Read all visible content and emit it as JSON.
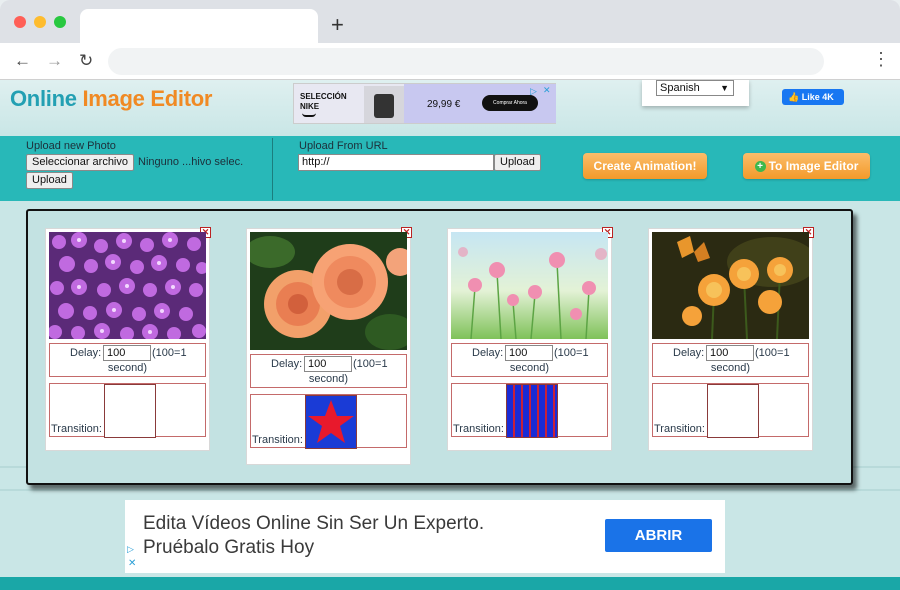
{
  "colors": {
    "teal_bar": "#28b8b8",
    "page_bg": "#c9e6e6",
    "orange_button": "#f39a2a",
    "logo_blue": "#23a0b3",
    "logo_orange": "#f08a24",
    "fb_blue": "#1877f2",
    "ad_button_blue": "#1a73e8"
  },
  "browser": {
    "new_tab_icon": "plus-icon",
    "back_icon": "arrow-left-icon",
    "forward_icon": "arrow-right-icon",
    "reload_icon": "reload-icon",
    "menu_icon": "kebab-icon"
  },
  "header": {
    "logo_part1": "Online ",
    "logo_part2": "Image Editor",
    "language_selected": "Spanish",
    "fb_like_label": "Like 4K"
  },
  "top_ad": {
    "brand_line1": "SELECCIÓN",
    "brand_line2": "NIKE",
    "price": "29,99 €",
    "cta": "Comprar Ahora"
  },
  "upload": {
    "photo_label": "Upload new Photo",
    "choose_file_label": "Seleccionar archivo",
    "file_status": "Ninguno ...hivo selec.",
    "upload_button": "Upload",
    "url_label": "Upload From URL",
    "url_value": "http://",
    "url_upload_button": "Upload",
    "create_animation_button": "Create Animation!",
    "to_editor_button": "To Image Editor"
  },
  "frames": [
    {
      "image": "purple flowers",
      "delay_label": "Delay:",
      "delay_value": "100",
      "delay_hint": "(100=1",
      "delay_unit": "second)",
      "transition_label": "Transition:",
      "transition": "none"
    },
    {
      "image": "orange roses",
      "delay_label": "Delay:",
      "delay_value": "100",
      "delay_hint": "(100=1",
      "delay_unit": "second)",
      "transition_label": "Transition:",
      "transition": "star"
    },
    {
      "image": "pink meadow flowers",
      "delay_label": "Delay:",
      "delay_value": "100",
      "delay_hint": "(100=1",
      "delay_unit": "second)",
      "transition_label": "Transition:",
      "transition": "pattern"
    },
    {
      "image": "butterfly on orange flowers",
      "delay_label": "Delay:",
      "delay_value": "100",
      "delay_hint": "(100=1",
      "delay_unit": "second)",
      "transition_label": "Transition:",
      "transition": "none"
    }
  ],
  "bottom_ad": {
    "line1": "Edita Vídeos Online Sin Ser Un Experto.",
    "line2": "Pruébalo Gratis Hoy",
    "cta": "ABRIR"
  }
}
